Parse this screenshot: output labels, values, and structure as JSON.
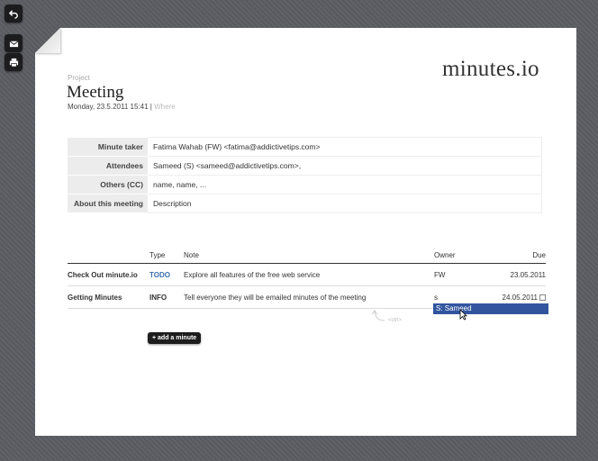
{
  "toolbar": {
    "back_icon": "undo-arrow-icon",
    "email_icon": "envelope-icon",
    "print_icon": "printer-icon"
  },
  "brand": "minutes.io",
  "meeting": {
    "project_label": "Project",
    "title": "Meeting",
    "date": "Monday, 23.5.2011 15:41",
    "separator": "|",
    "where_placeholder": "Where"
  },
  "info": {
    "minute_taker_label": "Minute taker",
    "minute_taker_value": "Fatima Wahab (FW) <fatima@addictivetips.com>",
    "attendees_label": "Attendees",
    "attendees_value": "Sameed (S) <sameed@addictivetips.com>,",
    "others_label": "Others (CC)",
    "others_placeholder": "name, name, ...",
    "about_label": "About this meeting",
    "about_placeholder": "Description"
  },
  "minutes": {
    "headers": {
      "type": "Type",
      "note": "Note",
      "owner": "Owner",
      "due": "Due"
    },
    "rows": [
      {
        "item": "Check Out minute.io",
        "type": "TODO",
        "note": "Explore all features of the free web service",
        "owner": "FW",
        "due": "23.05.2011"
      },
      {
        "item": "Getting Minutes",
        "type": "INFO",
        "note": "Tell everyone they will be emailed minutes of the meeting",
        "owner": "s",
        "due": "24.05.2011"
      }
    ],
    "suggestion": "S: Sameed",
    "hint": "<ctrl>",
    "add_label": "+ add a minute"
  },
  "colors": {
    "background": "#5b5d63",
    "todo": "#3a6fb0",
    "suggest": "#32559e"
  }
}
